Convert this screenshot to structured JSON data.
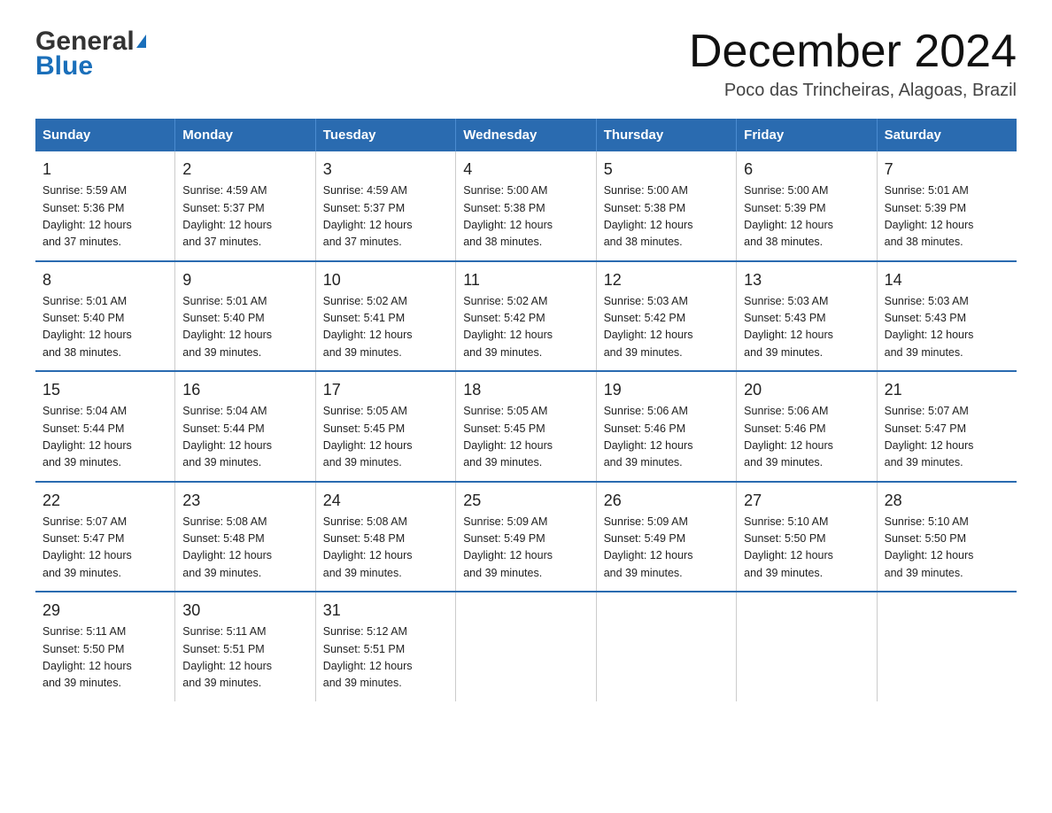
{
  "header": {
    "logo_general": "General",
    "logo_blue": "Blue",
    "title": "December 2024",
    "subtitle": "Poco das Trincheiras, Alagoas, Brazil"
  },
  "days_of_week": [
    "Sunday",
    "Monday",
    "Tuesday",
    "Wednesday",
    "Thursday",
    "Friday",
    "Saturday"
  ],
  "weeks": [
    [
      {
        "day": "1",
        "sunrise": "5:59 AM",
        "sunset": "5:36 PM",
        "daylight": "12 hours and 37 minutes."
      },
      {
        "day": "2",
        "sunrise": "4:59 AM",
        "sunset": "5:37 PM",
        "daylight": "12 hours and 37 minutes."
      },
      {
        "day": "3",
        "sunrise": "4:59 AM",
        "sunset": "5:37 PM",
        "daylight": "12 hours and 37 minutes."
      },
      {
        "day": "4",
        "sunrise": "5:00 AM",
        "sunset": "5:38 PM",
        "daylight": "12 hours and 38 minutes."
      },
      {
        "day": "5",
        "sunrise": "5:00 AM",
        "sunset": "5:38 PM",
        "daylight": "12 hours and 38 minutes."
      },
      {
        "day": "6",
        "sunrise": "5:00 AM",
        "sunset": "5:39 PM",
        "daylight": "12 hours and 38 minutes."
      },
      {
        "day": "7",
        "sunrise": "5:01 AM",
        "sunset": "5:39 PM",
        "daylight": "12 hours and 38 minutes."
      }
    ],
    [
      {
        "day": "8",
        "sunrise": "5:01 AM",
        "sunset": "5:40 PM",
        "daylight": "12 hours and 38 minutes."
      },
      {
        "day": "9",
        "sunrise": "5:01 AM",
        "sunset": "5:40 PM",
        "daylight": "12 hours and 39 minutes."
      },
      {
        "day": "10",
        "sunrise": "5:02 AM",
        "sunset": "5:41 PM",
        "daylight": "12 hours and 39 minutes."
      },
      {
        "day": "11",
        "sunrise": "5:02 AM",
        "sunset": "5:42 PM",
        "daylight": "12 hours and 39 minutes."
      },
      {
        "day": "12",
        "sunrise": "5:03 AM",
        "sunset": "5:42 PM",
        "daylight": "12 hours and 39 minutes."
      },
      {
        "day": "13",
        "sunrise": "5:03 AM",
        "sunset": "5:43 PM",
        "daylight": "12 hours and 39 minutes."
      },
      {
        "day": "14",
        "sunrise": "5:03 AM",
        "sunset": "5:43 PM",
        "daylight": "12 hours and 39 minutes."
      }
    ],
    [
      {
        "day": "15",
        "sunrise": "5:04 AM",
        "sunset": "5:44 PM",
        "daylight": "12 hours and 39 minutes."
      },
      {
        "day": "16",
        "sunrise": "5:04 AM",
        "sunset": "5:44 PM",
        "daylight": "12 hours and 39 minutes."
      },
      {
        "day": "17",
        "sunrise": "5:05 AM",
        "sunset": "5:45 PM",
        "daylight": "12 hours and 39 minutes."
      },
      {
        "day": "18",
        "sunrise": "5:05 AM",
        "sunset": "5:45 PM",
        "daylight": "12 hours and 39 minutes."
      },
      {
        "day": "19",
        "sunrise": "5:06 AM",
        "sunset": "5:46 PM",
        "daylight": "12 hours and 39 minutes."
      },
      {
        "day": "20",
        "sunrise": "5:06 AM",
        "sunset": "5:46 PM",
        "daylight": "12 hours and 39 minutes."
      },
      {
        "day": "21",
        "sunrise": "5:07 AM",
        "sunset": "5:47 PM",
        "daylight": "12 hours and 39 minutes."
      }
    ],
    [
      {
        "day": "22",
        "sunrise": "5:07 AM",
        "sunset": "5:47 PM",
        "daylight": "12 hours and 39 minutes."
      },
      {
        "day": "23",
        "sunrise": "5:08 AM",
        "sunset": "5:48 PM",
        "daylight": "12 hours and 39 minutes."
      },
      {
        "day": "24",
        "sunrise": "5:08 AM",
        "sunset": "5:48 PM",
        "daylight": "12 hours and 39 minutes."
      },
      {
        "day": "25",
        "sunrise": "5:09 AM",
        "sunset": "5:49 PM",
        "daylight": "12 hours and 39 minutes."
      },
      {
        "day": "26",
        "sunrise": "5:09 AM",
        "sunset": "5:49 PM",
        "daylight": "12 hours and 39 minutes."
      },
      {
        "day": "27",
        "sunrise": "5:10 AM",
        "sunset": "5:50 PM",
        "daylight": "12 hours and 39 minutes."
      },
      {
        "day": "28",
        "sunrise": "5:10 AM",
        "sunset": "5:50 PM",
        "daylight": "12 hours and 39 minutes."
      }
    ],
    [
      {
        "day": "29",
        "sunrise": "5:11 AM",
        "sunset": "5:50 PM",
        "daylight": "12 hours and 39 minutes."
      },
      {
        "day": "30",
        "sunrise": "5:11 AM",
        "sunset": "5:51 PM",
        "daylight": "12 hours and 39 minutes."
      },
      {
        "day": "31",
        "sunrise": "5:12 AM",
        "sunset": "5:51 PM",
        "daylight": "12 hours and 39 minutes."
      },
      null,
      null,
      null,
      null
    ]
  ],
  "labels": {
    "sunrise": "Sunrise:",
    "sunset": "Sunset:",
    "daylight": "Daylight: 12 hours"
  }
}
